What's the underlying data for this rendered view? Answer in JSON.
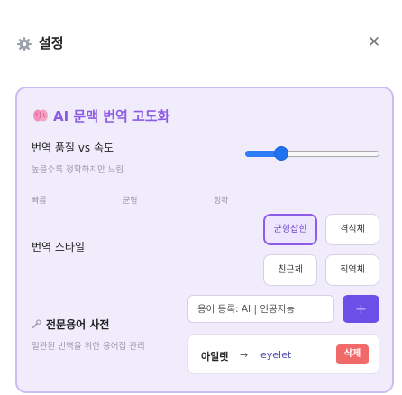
{
  "header": {
    "title": "설정",
    "gear_icon": "gear-icon",
    "close_glyph": "✕"
  },
  "panel": {
    "title": "AI 문맥 번역 고도화",
    "title_icon": "brain-icon",
    "quality": {
      "label": "번역 품질 vs 속도",
      "sub": "높을수록 정확하지만 느림",
      "slider_value": 0.27,
      "scale": [
        "빠름",
        "균형",
        "정확"
      ]
    },
    "style": {
      "label": "번역 스타일",
      "options": [
        "균형잡힌",
        "격식체",
        "친근체",
        "직역체"
      ],
      "selected": "균형잡힌"
    },
    "dictionary": {
      "label": "전문용어 사전",
      "icon": "wrench-icon",
      "sub": "일관된 번역을 위한 용어집 관리",
      "input_placeholder": "용어 등록: AI | 인공지능",
      "add_label": "+",
      "entries": [
        {
          "source": "아일렛",
          "arrow": "→",
          "target": "eyelet",
          "delete_label": "삭제"
        }
      ]
    }
  },
  "colors": {
    "accent": "#8c5ce6",
    "add_button": "#6b4fe6",
    "delete": "#f06a6a",
    "slider": "#2f7cf6",
    "panel_bg": "#f1ecfc"
  }
}
